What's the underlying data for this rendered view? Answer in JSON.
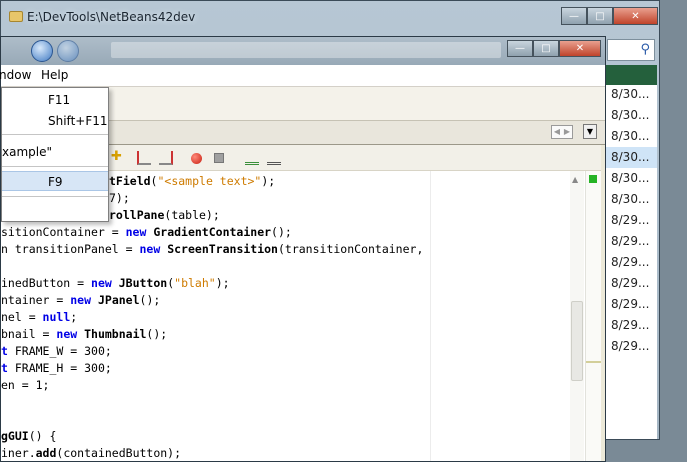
{
  "background_window": {
    "title": "E:\\DevTools\\NetBeans42dev",
    "file_dates": [
      "8/30...",
      "8/30...",
      "8/30...",
      "8/30...",
      "8/30...",
      "8/30...",
      "8/29...",
      "8/29...",
      "8/29...",
      "8/29...",
      "8/29...",
      "8/29...",
      "8/29..."
    ]
  },
  "menubar": {
    "window_label": "ndow",
    "help_label": "Help"
  },
  "dropdown": {
    "shortcut_1": "F11",
    "shortcut_2": "Shift+F11",
    "recent_label": "xample\"",
    "shortcut_3": "F9"
  },
  "code_lines": [
    {
      "pre": "",
      "cls": "tField",
      "post": "(",
      "str": "\"<sample text>\"",
      "tail": ");"
    },
    {
      "pre": "7);"
    },
    {
      "cls": "rollPane",
      "post": "(table);"
    },
    {
      "pre": "sitionContainer = ",
      "kw": "new",
      "cls": "GradientContainer",
      "post": "();"
    },
    {
      "pre": "n transitionPanel = ",
      "kw": "new",
      "cls": "ScreenTransition",
      "post": "(transitionContainer,"
    },
    {
      "pre": ""
    },
    {
      "pre": "inedButton = ",
      "kw": "new",
      "cls": "JButton",
      "post": "(",
      "str": "\"blah\"",
      "tail": ");"
    },
    {
      "pre": "ntainer = ",
      "kw": "new",
      "cls": "JPanel",
      "post": "();"
    },
    {
      "pre": "nel = ",
      "kw": "null",
      "post": ";"
    },
    {
      "pre": "bnail = ",
      "kw": "new",
      "cls": "Thumbnail",
      "post": "();"
    },
    {
      "kw": "t",
      "pre2": " FRAME_W = 300;"
    },
    {
      "kw": "t",
      "pre2": " FRAME_H = 300;"
    },
    {
      "pre": "en = 1;"
    },
    {
      "pre": ""
    },
    {
      "pre": ""
    },
    {
      "cls": "gGUI",
      "post": "() {"
    },
    {
      "pre": "iner.",
      "cls": "add",
      "post": "(containedButton);"
    }
  ],
  "colors": {
    "keyword": "#0000e6",
    "string": "#ce7b00",
    "menu_highlight": "#d7e6f6",
    "list_header": "#24603c"
  }
}
